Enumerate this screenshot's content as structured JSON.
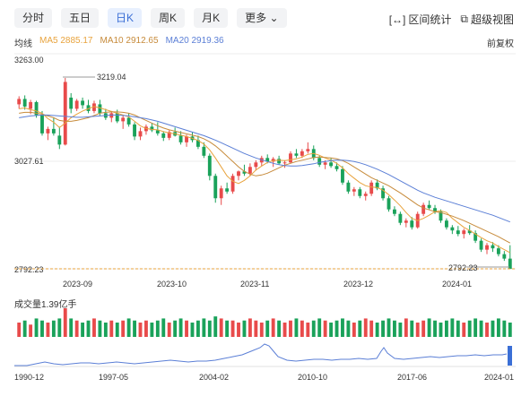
{
  "tabs": [
    {
      "label": "分时",
      "active": false
    },
    {
      "label": "五日",
      "active": false
    },
    {
      "label": "日K",
      "active": true
    },
    {
      "label": "周K",
      "active": false
    },
    {
      "label": "月K",
      "active": false
    },
    {
      "label": "更多",
      "active": false
    }
  ],
  "tools": {
    "range_stats": "区间统计",
    "super_view": "超级视图"
  },
  "ma_legend": {
    "label": "均线",
    "ma5": "MA5 2885.17",
    "ma10": "MA10 2912.65",
    "ma20": "MA20 2919.36"
  },
  "adjust": "前复权",
  "colors": {
    "up": "#e84b4b",
    "down": "#1aa25a",
    "ma5": "#e8a33d",
    "ma10": "#c78b3b",
    "ma20": "#5b7fd6",
    "accent": "#3b6fd6"
  },
  "chart_data": {
    "type": "candlestick",
    "y_axis_labels": [
      "3263.00",
      "3027.61",
      "2792.23"
    ],
    "ylim": [
      2792.23,
      3263.0
    ],
    "max_marker": "3219.04",
    "min_marker": "2792.23",
    "x_axis_labels": [
      "2023-09",
      "2023-10",
      "2023-11",
      "2023-12",
      "2024-01"
    ],
    "volume_label": "成交量1.39亿手",
    "overview_axis_labels": [
      "1990-12",
      "1997-05",
      "2004-02",
      "2010-10",
      "2017-06",
      "2024-01"
    ],
    "candles": [
      [
        3160,
        3178,
        3150,
        3172
      ],
      [
        3172,
        3180,
        3148,
        3155
      ],
      [
        3150,
        3170,
        3138,
        3165
      ],
      [
        3165,
        3168,
        3130,
        3136
      ],
      [
        3136,
        3145,
        3090,
        3095
      ],
      [
        3095,
        3110,
        3080,
        3105
      ],
      [
        3105,
        3130,
        3090,
        3095
      ],
      [
        3090,
        3110,
        3060,
        3070
      ],
      [
        3070,
        3219,
        3068,
        3210
      ],
      [
        3175,
        3185,
        3140,
        3150
      ],
      [
        3150,
        3172,
        3145,
        3168
      ],
      [
        3168,
        3175,
        3150,
        3158
      ],
      [
        3158,
        3170,
        3140,
        3145
      ],
      [
        3145,
        3168,
        3140,
        3162
      ],
      [
        3160,
        3170,
        3135,
        3140
      ],
      [
        3140,
        3150,
        3125,
        3130
      ],
      [
        3130,
        3145,
        3120,
        3140
      ],
      [
        3140,
        3148,
        3118,
        3122
      ],
      [
        3122,
        3135,
        3105,
        3130
      ],
      [
        3130,
        3140,
        3110,
        3115
      ],
      [
        3115,
        3120,
        3080,
        3088
      ],
      [
        3088,
        3108,
        3080,
        3100
      ],
      [
        3100,
        3115,
        3092,
        3110
      ],
      [
        3110,
        3118,
        3098,
        3102
      ],
      [
        3102,
        3120,
        3090,
        3095
      ],
      [
        3095,
        3100,
        3078,
        3085
      ],
      [
        3085,
        3102,
        3080,
        3098
      ],
      [
        3098,
        3108,
        3088,
        3090
      ],
      [
        3090,
        3100,
        3070,
        3075
      ],
      [
        3075,
        3092,
        3065,
        3088
      ],
      [
        3088,
        3098,
        3075,
        3080
      ],
      [
        3080,
        3090,
        3060,
        3065
      ],
      [
        3065,
        3075,
        3040,
        3045
      ],
      [
        3045,
        3050,
        2990,
        3000
      ],
      [
        3000,
        3005,
        2940,
        2950
      ],
      [
        2950,
        2978,
        2935,
        2972
      ],
      [
        2972,
        2985,
        2960,
        2965
      ],
      [
        2965,
        3005,
        2960,
        3000
      ],
      [
        3000,
        3012,
        2990,
        3010
      ],
      [
        3010,
        3025,
        3000,
        3005
      ],
      [
        3005,
        3028,
        3000,
        3020
      ],
      [
        3020,
        3035,
        3012,
        3030
      ],
      [
        3030,
        3045,
        3022,
        3040
      ],
      [
        3040,
        3048,
        3028,
        3032
      ],
      [
        3032,
        3042,
        3020,
        3038
      ],
      [
        3038,
        3045,
        3025,
        3028
      ],
      [
        3028,
        3035,
        3018,
        3030
      ],
      [
        3030,
        3055,
        3028,
        3050
      ],
      [
        3050,
        3060,
        3040,
        3045
      ],
      [
        3045,
        3060,
        3040,
        3055
      ],
      [
        3055,
        3075,
        3050,
        3060
      ],
      [
        3060,
        3068,
        3035,
        3040
      ],
      [
        3040,
        3045,
        3020,
        3025
      ],
      [
        3025,
        3035,
        3015,
        3030
      ],
      [
        3030,
        3040,
        3018,
        3022
      ],
      [
        3022,
        3030,
        3010,
        3015
      ],
      [
        3015,
        3022,
        2980,
        2985
      ],
      [
        2985,
        2990,
        2960,
        2965
      ],
      [
        2965,
        2975,
        2955,
        2970
      ],
      [
        2970,
        2975,
        2950,
        2955
      ],
      [
        2955,
        2965,
        2945,
        2960
      ],
      [
        2960,
        2990,
        2955,
        2985
      ],
      [
        2985,
        2992,
        2968,
        2972
      ],
      [
        2972,
        2978,
        2945,
        2950
      ],
      [
        2950,
        2955,
        2920,
        2925
      ],
      [
        2925,
        2932,
        2910,
        2915
      ],
      [
        2915,
        2920,
        2890,
        2895
      ],
      [
        2895,
        2905,
        2885,
        2900
      ],
      [
        2900,
        2908,
        2880,
        2885
      ],
      [
        2885,
        2920,
        2882,
        2915
      ],
      [
        2915,
        2940,
        2910,
        2935
      ],
      [
        2935,
        2945,
        2925,
        2928
      ],
      [
        2928,
        2935,
        2915,
        2920
      ],
      [
        2920,
        2925,
        2895,
        2900
      ],
      [
        2900,
        2905,
        2880,
        2885
      ],
      [
        2885,
        2890,
        2870,
        2878
      ],
      [
        2878,
        2888,
        2865,
        2870
      ],
      [
        2870,
        2882,
        2860,
        2878
      ],
      [
        2878,
        2890,
        2868,
        2872
      ],
      [
        2872,
        2878,
        2850,
        2855
      ],
      [
        2855,
        2860,
        2830,
        2835
      ],
      [
        2835,
        2850,
        2825,
        2845
      ],
      [
        2845,
        2852,
        2830,
        2838
      ],
      [
        2838,
        2845,
        2820,
        2825
      ],
      [
        2825,
        2832,
        2810,
        2815
      ],
      [
        2815,
        2845,
        2800,
        2792
      ]
    ],
    "ma5": [
      3150,
      3152,
      3148,
      3145,
      3140,
      3128,
      3120,
      3108,
      3118,
      3130,
      3138,
      3145,
      3150,
      3155,
      3152,
      3148,
      3144,
      3140,
      3136,
      3132,
      3122,
      3112,
      3106,
      3104,
      3103,
      3099,
      3096,
      3094,
      3091,
      3088,
      3084,
      3079,
      3071,
      3058,
      3040,
      3020,
      3000,
      2988,
      2983,
      2990,
      3000,
      3013,
      3022,
      3030,
      3034,
      3035,
      3034,
      3036,
      3038,
      3042,
      3048,
      3050,
      3046,
      3040,
      3035,
      3028,
      3018,
      3005,
      2995,
      2985,
      2978,
      2975,
      2974,
      2968,
      2958,
      2946,
      2933,
      2918,
      2905,
      2900,
      2905,
      2912,
      2920,
      2922,
      2918,
      2905,
      2895,
      2885,
      2878,
      2870,
      2862,
      2855,
      2850,
      2842,
      2835,
      2828
    ],
    "ma10": [
      3140,
      3142,
      3142,
      3140,
      3138,
      3134,
      3130,
      3124,
      3122,
      3122,
      3124,
      3127,
      3130,
      3135,
      3140,
      3142,
      3143,
      3143,
      3142,
      3140,
      3136,
      3130,
      3124,
      3118,
      3112,
      3107,
      3103,
      3100,
      3097,
      3094,
      3091,
      3088,
      3083,
      3076,
      3067,
      3056,
      3044,
      3032,
      3020,
      3010,
      3004,
      3000,
      3002,
      3006,
      3012,
      3018,
      3024,
      3028,
      3032,
      3035,
      3038,
      3041,
      3042,
      3041,
      3040,
      3038,
      3034,
      3028,
      3020,
      3012,
      3004,
      2996,
      2990,
      2984,
      2978,
      2970,
      2962,
      2953,
      2944,
      2935,
      2928,
      2924,
      2920,
      2918,
      2914,
      2910,
      2905,
      2900,
      2894,
      2888,
      2882,
      2876,
      2870,
      2864,
      2857,
      2850
    ],
    "ma20": [
      3130,
      3132,
      3134,
      3135,
      3136,
      3136,
      3135,
      3134,
      3133,
      3132,
      3131,
      3131,
      3132,
      3133,
      3134,
      3135,
      3136,
      3136,
      3135,
      3134,
      3132,
      3130,
      3128,
      3125,
      3122,
      3118,
      3114,
      3110,
      3106,
      3102,
      3098,
      3094,
      3090,
      3085,
      3080,
      3074,
      3068,
      3062,
      3056,
      3050,
      3045,
      3040,
      3036,
      3032,
      3028,
      3025,
      3023,
      3022,
      3022,
      3023,
      3025,
      3027,
      3030,
      3032,
      3034,
      3035,
      3035,
      3034,
      3032,
      3029,
      3025,
      3020,
      3015,
      3009,
      3003,
      2996,
      2989,
      2982,
      2975,
      2968,
      2962,
      2957,
      2952,
      2948,
      2944,
      2940,
      2936,
      2932,
      2928,
      2924,
      2920,
      2916,
      2912,
      2907,
      2902,
      2897
    ],
    "volumes": [
      7,
      8,
      6,
      9,
      8,
      7,
      8,
      9,
      14,
      9,
      8,
      7,
      8,
      9,
      8,
      7,
      8,
      7,
      8,
      9,
      8,
      7,
      8,
      7,
      8,
      9,
      7,
      8,
      9,
      8,
      7,
      8,
      9,
      8,
      10,
      9,
      8,
      8,
      7,
      8,
      9,
      8,
      7,
      8,
      9,
      8,
      7,
      8,
      9,
      8,
      7,
      8,
      9,
      8,
      7,
      8,
      9,
      8,
      7,
      8,
      9,
      8,
      7,
      8,
      9,
      8,
      7,
      9,
      8,
      7,
      8,
      9,
      8,
      7,
      8,
      9,
      8,
      7,
      8,
      9,
      8,
      7,
      8,
      9,
      8,
      7
    ]
  }
}
